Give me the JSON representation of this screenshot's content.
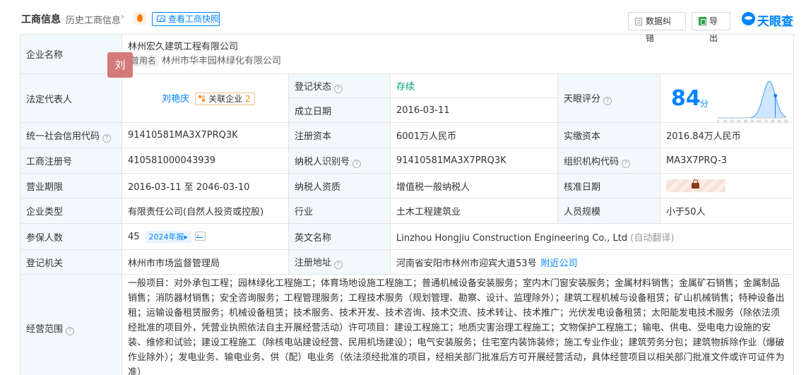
{
  "header": {
    "title": "工商信息",
    "history": "历史工商信息",
    "chevron": "›",
    "snapshot": "查看工商快照",
    "error_btn": "数据纠错",
    "export_btn": "导出",
    "brand": "天眼查"
  },
  "company": {
    "name_label": "企业名称",
    "name": "林州宏久建筑工程有限公司",
    "former_tag": "曾用名",
    "former_name": "林州市华丰园林绿化有限公司"
  },
  "rep": {
    "label": "法定代表人",
    "avatar": "刘",
    "name": "刘艳庆",
    "rel_text": "关联企业",
    "rel_count": "2"
  },
  "reg_status": {
    "label": "登记状态",
    "value": "存续"
  },
  "found_date": {
    "label": "成立日期",
    "value": "2016-03-11"
  },
  "score": {
    "label": "天眼评分",
    "value": "84",
    "unit": "分",
    "axis_ticks": [
      "0",
      "10",
      "20",
      "30",
      "40",
      "50",
      "60",
      "70",
      "80",
      "90",
      "100"
    ]
  },
  "rows": {
    "credit_code": {
      "label": "统一社会信用代码",
      "value": "91410581MA3X7PRQ3K"
    },
    "reg_capital": {
      "label": "注册资本",
      "value": "6001万人民币"
    },
    "paid_capital": {
      "label": "实缴资本",
      "value": "2016.84万人民币"
    },
    "reg_no": {
      "label": "工商注册号",
      "value": "410581000043939"
    },
    "taxpayer_id": {
      "label": "纳税人识别号",
      "value": "91410581MA3X7PRQ3K"
    },
    "org_code": {
      "label": "组织机构代码",
      "value": "MA3X7PRQ-3"
    },
    "term": {
      "label": "营业期限",
      "value": "2016-03-11 至 2046-03-10"
    },
    "taxpayer_type": {
      "label": "纳税人资质",
      "value": "增值税一般纳税人"
    },
    "approval_date": {
      "label": "核准日期"
    },
    "company_type": {
      "label": "企业类型",
      "value": "有限责任公司(自然人投资或控股)"
    },
    "industry": {
      "label": "行业",
      "value": "土木工程建筑业"
    },
    "staff_size": {
      "label": "人员规模",
      "value": "小于50人"
    },
    "insured": {
      "label": "参保人数",
      "value": "45",
      "year": "2024年报▸"
    },
    "english_name": {
      "label": "英文名称",
      "value": "Linzhou Hongjiu Construction Engineering Co., Ltd",
      "auto": "(自动翻译)"
    },
    "reg_authority": {
      "label": "登记机关",
      "value": "林州市市场监督管理局"
    },
    "reg_address": {
      "label": "注册地址",
      "value": "河南省安阳市林州市迎宾大道53号",
      "nearby": "附近公司"
    },
    "scope": {
      "label": "经营范围",
      "value": "一般项目：对外承包工程；园林绿化工程施工；体育场地设施工程施工；普通机械设备安装服务；室内木门窗安装服务；金属材料销售；金属矿石销售；金属制品销售；消防器材销售；安全咨询服务；工程管理服务；工程技术服务（规划管理、勘察、设计、监理除外）；建筑工程机械与设备租赁；矿山机械销售；特种设备出租；运输设备租赁服务；机械设备租赁；技术服务、技术开发、技术咨询、技术交流、技术转让、技术推广；光伏发电设备租赁；太阳能发电技术服务（除依法须经批准的项目外，凭营业执照依法自主开展经营活动）许可项目：建设工程施工；地质灾害治理工程施工；文物保护工程施工；输电、供电、受电电力设施的安装、维修和试验；建设工程施工（除核电站建设经营、民用机场建设）；电气安装服务；住宅室内装饰装修；施工专业作业；建筑劳务分包；建筑物拆除作业（爆破作业除外）；发电业务、输电业务、供（配）电业务（依法须经批准的项目，经相关部门批准后方可开展经营活动，具体经营项目以相关部门批准文件或许可证件为准）"
    }
  },
  "icons": {
    "help": "?",
    "fire": "fire-icon",
    "camera": "camera-icon",
    "lock": "lock-icon"
  },
  "colors": {
    "accent": "#0084ff",
    "label_bg": "#f2f9fc",
    "status_ok": "#00a37a",
    "orange": "#ff8b1a"
  }
}
